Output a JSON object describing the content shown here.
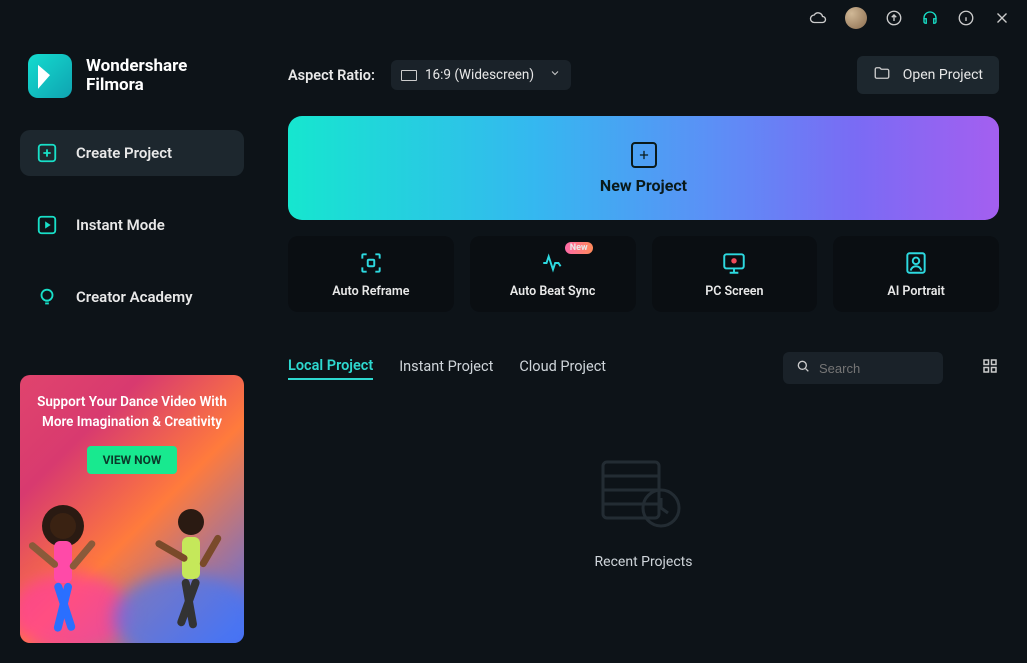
{
  "brand": {
    "name1": "Wondershare",
    "name2": "Filmora"
  },
  "titlebar": {
    "icons": [
      "cloud",
      "avatar",
      "upload",
      "headset",
      "info",
      "close"
    ]
  },
  "sidebar": {
    "items": [
      {
        "icon": "plus-box",
        "label": "Create Project",
        "active": true
      },
      {
        "icon": "play-box",
        "label": "Instant Mode",
        "active": false
      },
      {
        "icon": "bulb",
        "label": "Creator Academy",
        "active": false
      }
    ],
    "promo": {
      "line1": "Support Your Dance Video With",
      "line2": "More Imagination & Creativity",
      "cta": "VIEW NOW"
    }
  },
  "toprow": {
    "aspect_label": "Aspect Ratio:",
    "aspect_value": "16:9 (Widescreen)",
    "open_project": "Open Project"
  },
  "new_project_label": "New Project",
  "actions": [
    {
      "key": "auto-reframe",
      "label": "Auto Reframe",
      "badge": null
    },
    {
      "key": "auto-beat-sync",
      "label": "Auto Beat Sync",
      "badge": "New"
    },
    {
      "key": "pc-screen",
      "label": "PC Screen",
      "badge": null
    },
    {
      "key": "ai-portrait",
      "label": "AI Portrait",
      "badge": null
    }
  ],
  "tabs": [
    {
      "label": "Local Project",
      "active": true
    },
    {
      "label": "Instant Project",
      "active": false
    },
    {
      "label": "Cloud Project",
      "active": false
    }
  ],
  "search": {
    "placeholder": "Search",
    "value": ""
  },
  "recent_label": "Recent Projects"
}
